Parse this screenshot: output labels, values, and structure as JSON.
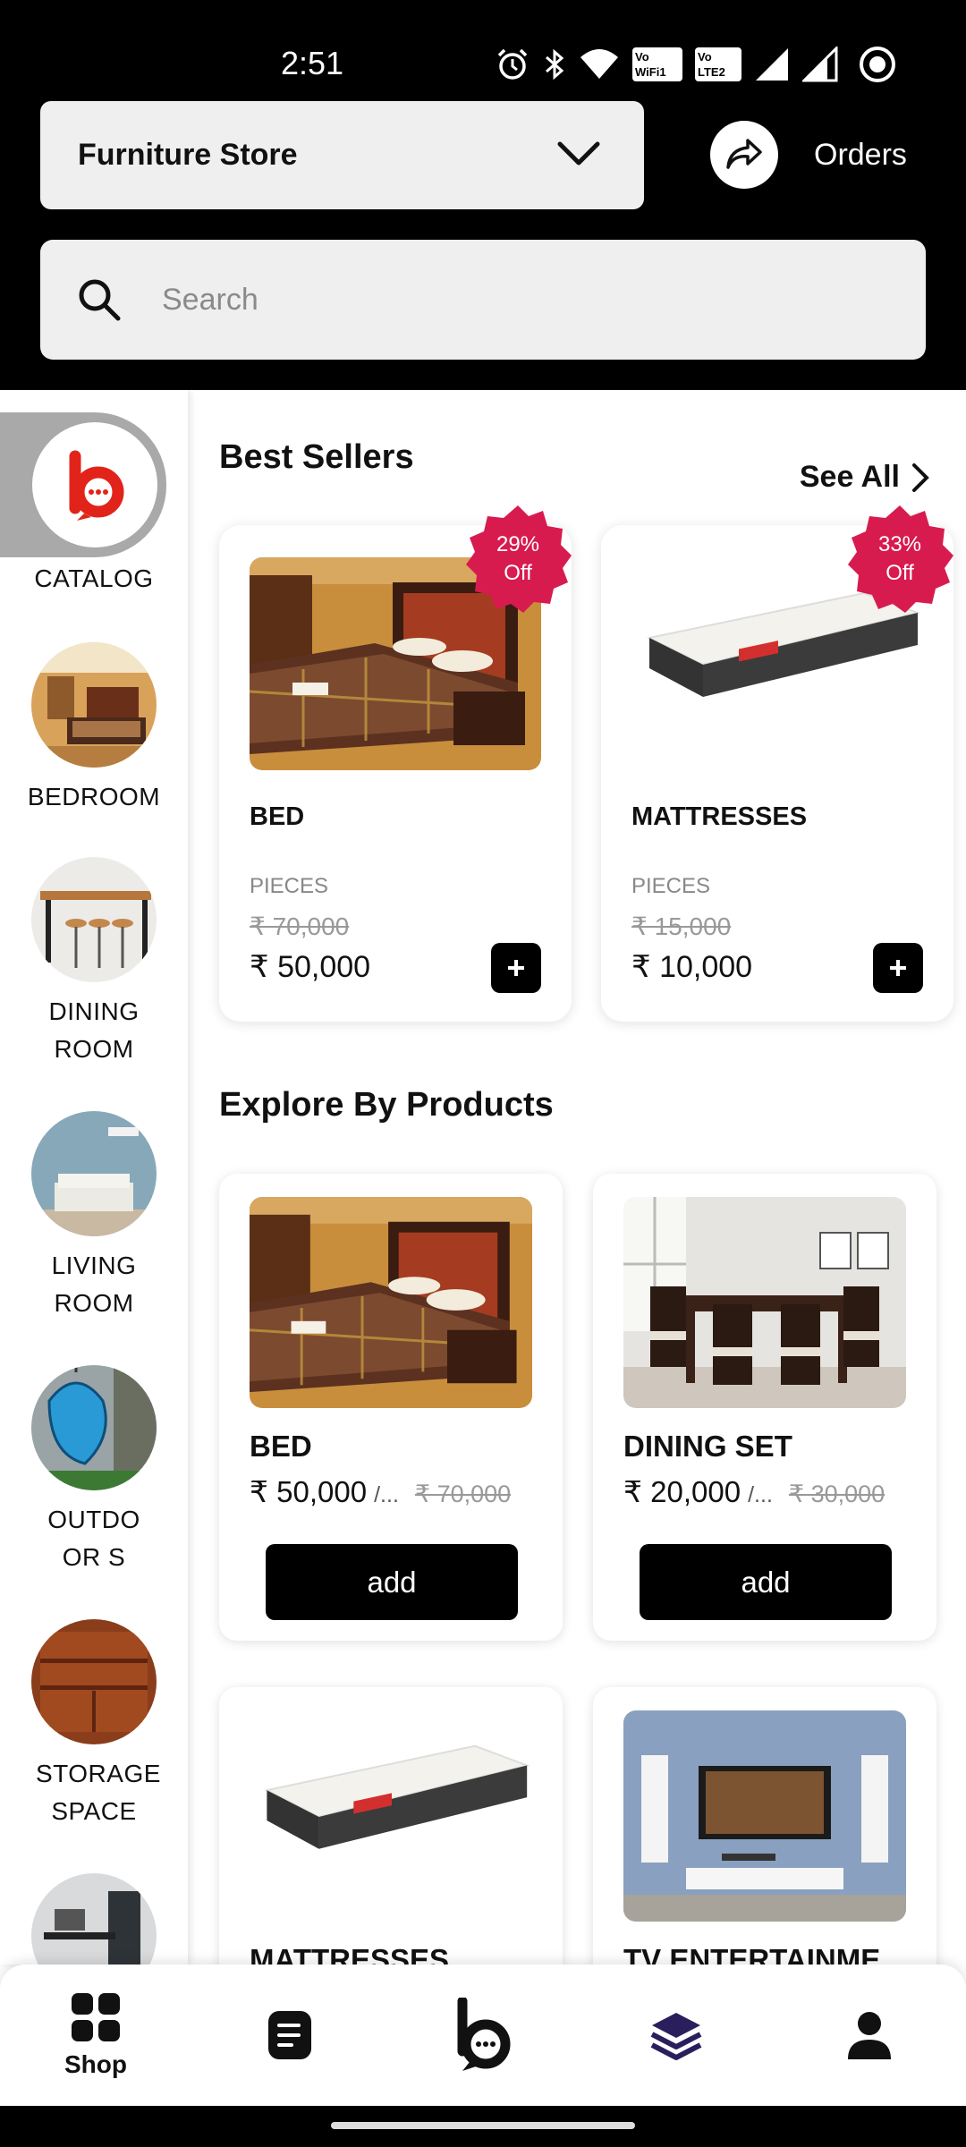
{
  "status_bar": {
    "time": "2:51",
    "icons": [
      "alarm-icon",
      "bluetooth-icon",
      "wifi-icon",
      "vowifi-icon",
      "volte-icon",
      "signal-icon",
      "signal-icon",
      "record-icon"
    ],
    "vowifi_top": "Vo",
    "vowifi_bottom": "WiFi1",
    "volte_top": "Vo",
    "volte_bottom": "LTE2"
  },
  "header": {
    "store_name": "Furniture Store",
    "orders_label": "Orders"
  },
  "search": {
    "placeholder": "Search"
  },
  "sidebar": {
    "items": [
      {
        "label": "CATALOG"
      },
      {
        "label": "BEDROOM"
      },
      {
        "label": "DINING ROOM"
      },
      {
        "label": "LIVING ROOM"
      },
      {
        "label": "OUTDOOR S"
      },
      {
        "label": "STORAGE SPACE"
      }
    ]
  },
  "best_sellers": {
    "title": "Best Sellers",
    "see_all": "See All",
    "items": [
      {
        "name": "BED",
        "unit": "PIECES",
        "mrp": "₹ 70,000",
        "price": "₹ 50,000",
        "discount_pct": "29%",
        "discount_off": "Off"
      },
      {
        "name": "MATTRESSES",
        "unit": "PIECES",
        "mrp": "₹ 15,000",
        "price": "₹ 10,000",
        "discount_pct": "33%",
        "discount_off": "Off"
      }
    ]
  },
  "explore": {
    "title": "Explore By Products",
    "add_label": "add",
    "items": [
      {
        "name": "BED",
        "price": "₹ 50,000",
        "unit": "/...",
        "mrp": "₹ 70,000"
      },
      {
        "name": "DINING SET",
        "price": "₹ 20,000",
        "unit": "/...",
        "mrp": "₹ 30,000"
      },
      {
        "name": "MATTRESSES"
      },
      {
        "name": "TV ENTERTAINME..."
      }
    ]
  },
  "bottom_nav": {
    "shop_label": "Shop",
    "icons": [
      "grid-icon",
      "orders-list-icon",
      "brand-logo-icon",
      "layers-icon",
      "profile-icon"
    ]
  },
  "colors": {
    "header_bg": "#000000",
    "badge": "#d81b4f",
    "brand_red": "#e2231a",
    "accent_dark": "#2a1e5c"
  }
}
